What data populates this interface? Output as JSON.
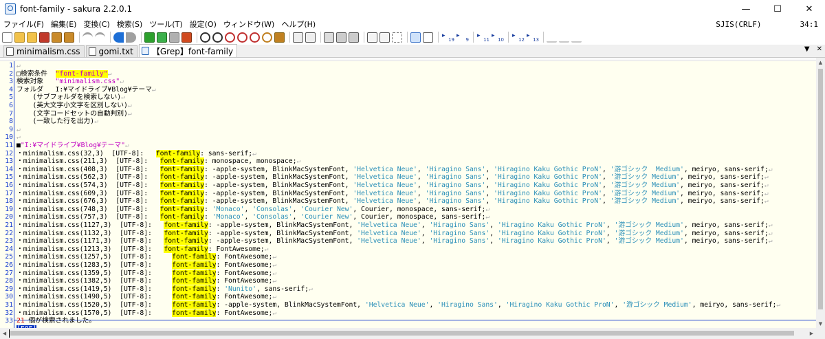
{
  "window": {
    "title": "font-family - sakura 2.2.0.1",
    "minimize_glyph": "—",
    "maximize_glyph": "☐",
    "close_glyph": "✕"
  },
  "menu": {
    "items": [
      "ファイル(F)",
      "編集(E)",
      "変換(C)",
      "検索(S)",
      "ツール(T)",
      "設定(O)",
      "ウィンドウ(W)",
      "ヘルプ(H)"
    ],
    "encoding": "SJIS(CRLF)",
    "cursor_pos": "34:1"
  },
  "tabs": [
    {
      "label": "minimalism.css",
      "icon": "document-icon"
    },
    {
      "label": "gomi.txt",
      "icon": "document-icon"
    },
    {
      "label": "【Grep】font-family",
      "icon": "grep-icon"
    }
  ],
  "tabbar_controls": {
    "dropdown": "▼",
    "close": "✕"
  },
  "toolbar_numbers": [
    "19",
    "9",
    "11",
    "10",
    "12",
    "13"
  ],
  "editor": {
    "eol_mark": "↵",
    "eof_label": "[EOF]",
    "lines": [
      {
        "n": "1",
        "segs": []
      },
      {
        "n": "2",
        "segs": [
          {
            "t": "□検索条件  "
          },
          {
            "t": "\"font-family\"",
            "c": "hl mag"
          }
        ]
      },
      {
        "n": "3",
        "segs": [
          {
            "t": "検索対象   "
          },
          {
            "t": "\"minimalism.css\"",
            "c": "mag"
          }
        ]
      },
      {
        "n": "4",
        "segs": [
          {
            "t": "フォルダ   I:¥マイドライブ¥Blog¥テーマ"
          }
        ]
      },
      {
        "n": "5",
        "segs": [
          {
            "t": "    (サブフォルダを検索しない)"
          }
        ]
      },
      {
        "n": "6",
        "segs": [
          {
            "t": "    (英大文字小文字を区別しない)"
          }
        ]
      },
      {
        "n": "7",
        "segs": [
          {
            "t": "    (文字コードセットの自動判別)"
          }
        ]
      },
      {
        "n": "8",
        "segs": [
          {
            "t": "    (一致した行を出力)"
          }
        ]
      },
      {
        "n": "9",
        "segs": []
      },
      {
        "n": "10",
        "segs": []
      },
      {
        "n": "11",
        "segs": [
          {
            "t": "■"
          },
          {
            "t": "\"I:¥マイドライブ¥Blog¥テーマ\"",
            "c": "mag"
          }
        ]
      },
      {
        "n": "12",
        "segs": [
          {
            "t": "・minimalism.css(32,3)  [UTF-8]:   "
          },
          {
            "t": "font-family",
            "c": "hl"
          },
          {
            "t": ": sans-serif;"
          }
        ]
      },
      {
        "n": "13",
        "segs": [
          {
            "t": "・minimalism.css(211,3)  [UTF-8]:   "
          },
          {
            "t": "font-family",
            "c": "hl"
          },
          {
            "t": ": monospace, monospace;"
          }
        ]
      },
      {
        "n": "14",
        "segs": [
          {
            "t": "・minimalism.css(408,3)  [UTF-8]:   "
          },
          {
            "t": "font-family",
            "c": "hl"
          },
          {
            "t": ": -apple-system, BlinkMacSystemFont, "
          },
          {
            "t": "'Helvetica Neue'",
            "c": "str"
          },
          {
            "t": ", "
          },
          {
            "t": "'Hiragino Sans'",
            "c": "str"
          },
          {
            "t": ", "
          },
          {
            "t": "'Hiragino Kaku Gothic ProN'",
            "c": "str"
          },
          {
            "t": ", "
          },
          {
            "t": "'游ゴシック  Medium'",
            "c": "str"
          },
          {
            "t": ", meiryo, sans-serif;"
          }
        ]
      },
      {
        "n": "15",
        "segs": [
          {
            "t": "・minimalism.css(562,3)  [UTF-8]:   "
          },
          {
            "t": "font-family",
            "c": "hl"
          },
          {
            "t": ": -apple-system, BlinkMacSystemFont, "
          },
          {
            "t": "'Helvetica Neue'",
            "c": "str"
          },
          {
            "t": ", "
          },
          {
            "t": "'Hiragino Sans'",
            "c": "str"
          },
          {
            "t": ", "
          },
          {
            "t": "'Hiragino Kaku Gothic ProN'",
            "c": "str"
          },
          {
            "t": ", "
          },
          {
            "t": "'游ゴシック Medium'",
            "c": "str"
          },
          {
            "t": ", meiryo, sans-serif;"
          }
        ]
      },
      {
        "n": "16",
        "segs": [
          {
            "t": "・minimalism.css(574,3)  [UTF-8]:   "
          },
          {
            "t": "font-family",
            "c": "hl"
          },
          {
            "t": ": -apple-system, BlinkMacSystemFont, "
          },
          {
            "t": "'Helvetica Neue'",
            "c": "str"
          },
          {
            "t": ", "
          },
          {
            "t": "'Hiragino Sans'",
            "c": "str"
          },
          {
            "t": ", "
          },
          {
            "t": "'Hiragino Kaku Gothic ProN'",
            "c": "str"
          },
          {
            "t": ", "
          },
          {
            "t": "'游ゴシック Medium'",
            "c": "str"
          },
          {
            "t": ", meiryo, sans-serif;"
          }
        ]
      },
      {
        "n": "17",
        "segs": [
          {
            "t": "・minimalism.css(609,3)  [UTF-8]:   "
          },
          {
            "t": "font-family",
            "c": "hl"
          },
          {
            "t": ": -apple-system, BlinkMacSystemFont, "
          },
          {
            "t": "'Helvetica Neue'",
            "c": "str"
          },
          {
            "t": ", "
          },
          {
            "t": "'Hiragino Sans'",
            "c": "str"
          },
          {
            "t": ", "
          },
          {
            "t": "'Hiragino Kaku Gothic ProN'",
            "c": "str"
          },
          {
            "t": ", "
          },
          {
            "t": "'游ゴシック Medium'",
            "c": "str"
          },
          {
            "t": ", meiryo, sans-serif;"
          }
        ]
      },
      {
        "n": "18",
        "segs": [
          {
            "t": "・minimalism.css(676,3)  [UTF-8]:   "
          },
          {
            "t": "font-family",
            "c": "hl"
          },
          {
            "t": ": -apple-system, BlinkMacSystemFont, "
          },
          {
            "t": "'Helvetica Neue'",
            "c": "str"
          },
          {
            "t": ", "
          },
          {
            "t": "'Hiragino Sans'",
            "c": "str"
          },
          {
            "t": ", "
          },
          {
            "t": "'Hiragino Kaku Gothic ProN'",
            "c": "str"
          },
          {
            "t": ", "
          },
          {
            "t": "'游ゴシック Medium'",
            "c": "str"
          },
          {
            "t": ", meiryo, sans-serif;"
          }
        ]
      },
      {
        "n": "19",
        "segs": [
          {
            "t": "・minimalism.css(748,3)  [UTF-8]:   "
          },
          {
            "t": "font-family",
            "c": "hl"
          },
          {
            "t": ": "
          },
          {
            "t": "'Monaco'",
            "c": "str"
          },
          {
            "t": ", "
          },
          {
            "t": "'Consolas'",
            "c": "str"
          },
          {
            "t": ", "
          },
          {
            "t": "'Courier New'",
            "c": "str"
          },
          {
            "t": ", Courier, monospace, sans-serif;"
          }
        ]
      },
      {
        "n": "20",
        "segs": [
          {
            "t": "・minimalism.css(757,3)  [UTF-8]:   "
          },
          {
            "t": "font-family",
            "c": "hl"
          },
          {
            "t": ": "
          },
          {
            "t": "'Monaco'",
            "c": "str"
          },
          {
            "t": ", "
          },
          {
            "t": "'Consolas'",
            "c": "str"
          },
          {
            "t": ", "
          },
          {
            "t": "'Courier New'",
            "c": "str"
          },
          {
            "t": ", Courier, monospace, sans-serif;"
          }
        ]
      },
      {
        "n": "21",
        "segs": [
          {
            "t": "・minimalism.css(1127,3)  [UTF-8]:   "
          },
          {
            "t": "font-family",
            "c": "hl"
          },
          {
            "t": ": -apple-system, BlinkMacSystemFont, "
          },
          {
            "t": "'Helvetica Neue'",
            "c": "str"
          },
          {
            "t": ", "
          },
          {
            "t": "'Hiragino Sans'",
            "c": "str"
          },
          {
            "t": ", "
          },
          {
            "t": "'Hiragino Kaku Gothic ProN'",
            "c": "str"
          },
          {
            "t": ", "
          },
          {
            "t": "'游ゴシック Medium'",
            "c": "str"
          },
          {
            "t": ", meiryo, sans-serif;"
          }
        ]
      },
      {
        "n": "22",
        "segs": [
          {
            "t": "・minimalism.css(1132,3)  [UTF-8]:   "
          },
          {
            "t": "font-family",
            "c": "hl"
          },
          {
            "t": ": -apple-system, BlinkMacSystemFont, "
          },
          {
            "t": "'Helvetica Neue'",
            "c": "str"
          },
          {
            "t": ", "
          },
          {
            "t": "'Hiragino Sans'",
            "c": "str"
          },
          {
            "t": ", "
          },
          {
            "t": "'Hiragino Kaku Gothic ProN'",
            "c": "str"
          },
          {
            "t": ", "
          },
          {
            "t": "'游ゴシック Medium'",
            "c": "str"
          },
          {
            "t": ", meiryo, sans-serif;"
          }
        ]
      },
      {
        "n": "23",
        "segs": [
          {
            "t": "・minimalism.css(1171,3)  [UTF-8]:   "
          },
          {
            "t": "font-family",
            "c": "hl"
          },
          {
            "t": ": -apple-system, BlinkMacSystemFont, "
          },
          {
            "t": "'Helvetica Neue'",
            "c": "str"
          },
          {
            "t": ", "
          },
          {
            "t": "'Hiragino Sans'",
            "c": "str"
          },
          {
            "t": ", "
          },
          {
            "t": "'Hiragino Kaku Gothic ProN'",
            "c": "str"
          },
          {
            "t": ", "
          },
          {
            "t": "'游ゴシック Medium'",
            "c": "str"
          },
          {
            "t": ", meiryo, sans-serif;"
          }
        ]
      },
      {
        "n": "24",
        "segs": [
          {
            "t": "・minimalism.css(1213,3)  [UTF-8]:   "
          },
          {
            "t": "font-family",
            "c": "hl"
          },
          {
            "t": ": FontAwesome;"
          }
        ]
      },
      {
        "n": "25",
        "segs": [
          {
            "t": "・minimalism.css(1257,5)  [UTF-8]:     "
          },
          {
            "t": "font-family",
            "c": "hl"
          },
          {
            "t": ": FontAwesome;"
          }
        ]
      },
      {
        "n": "26",
        "segs": [
          {
            "t": "・minimalism.css(1283,5)  [UTF-8]:     "
          },
          {
            "t": "font-family",
            "c": "hl"
          },
          {
            "t": ": FontAwesome;"
          }
        ]
      },
      {
        "n": "27",
        "segs": [
          {
            "t": "・minimalism.css(1359,5)  [UTF-8]:     "
          },
          {
            "t": "font-family",
            "c": "hl"
          },
          {
            "t": ": FontAwesome;"
          }
        ]
      },
      {
        "n": "28",
        "segs": [
          {
            "t": "・minimalism.css(1382,5)  [UTF-8]:     "
          },
          {
            "t": "font-family",
            "c": "hl"
          },
          {
            "t": ": FontAwesome;"
          }
        ]
      },
      {
        "n": "29",
        "segs": [
          {
            "t": "・minimalism.css(1419,5)  [UTF-8]:     "
          },
          {
            "t": "font-family",
            "c": "hl"
          },
          {
            "t": ": "
          },
          {
            "t": "'Nunito'",
            "c": "str"
          },
          {
            "t": ", sans-serif;"
          }
        ]
      },
      {
        "n": "30",
        "segs": [
          {
            "t": "・minimalism.css(1490,5)  [UTF-8]:     "
          },
          {
            "t": "font-family",
            "c": "hl"
          },
          {
            "t": ": FontAwesome;"
          }
        ]
      },
      {
        "n": "31",
        "segs": [
          {
            "t": "・minimalism.css(1520,5)  [UTF-8]:     "
          },
          {
            "t": "font-family",
            "c": "hl"
          },
          {
            "t": ": -apple-system, BlinkMacSystemFont, "
          },
          {
            "t": "'Helvetica Neue'",
            "c": "str"
          },
          {
            "t": ", "
          },
          {
            "t": "'Hiragino Sans'",
            "c": "str"
          },
          {
            "t": ", "
          },
          {
            "t": "'Hiragino Kaku Gothic ProN'",
            "c": "str"
          },
          {
            "t": ", "
          },
          {
            "t": "'游ゴシック Medium'",
            "c": "str"
          },
          {
            "t": ", meiryo, sans-serif;"
          }
        ]
      },
      {
        "n": "32",
        "segs": [
          {
            "t": "・minimalism.css(1570,5)  [UTF-8]:     "
          },
          {
            "t": "font-family",
            "c": "hl"
          },
          {
            "t": ": FontAwesome;"
          }
        ]
      },
      {
        "n": "33",
        "segs": [
          {
            "t": "21",
            "c": "red"
          },
          {
            "t": " 個が検索されました。"
          }
        ]
      }
    ]
  }
}
